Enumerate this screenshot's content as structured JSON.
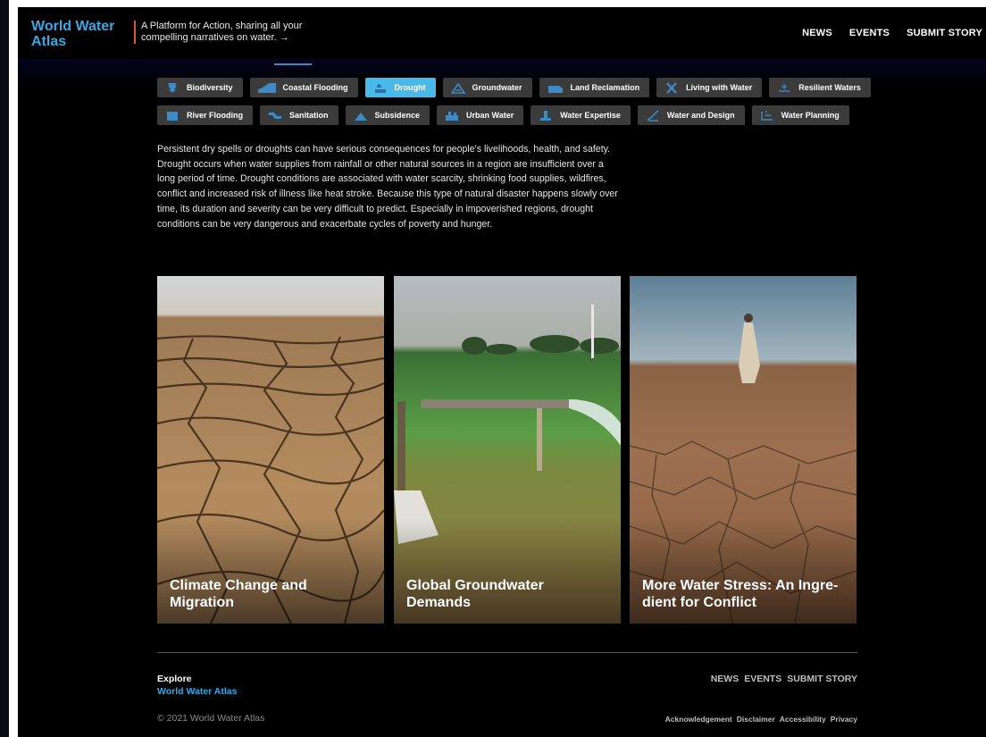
{
  "header": {
    "logo": "World Water Atlas",
    "tagline": "A Platform for Action, sharing all your compelling narratives on water. →",
    "nav": [
      "NEWS",
      "EVENTS",
      "SUBMIT STORY"
    ]
  },
  "topics": {
    "row1": [
      {
        "label": "Biodiversity",
        "icon": "biodiversity-icon"
      },
      {
        "label": "Coastal Flooding",
        "icon": "coastal-flooding-icon"
      },
      {
        "label": "Drought",
        "icon": "drought-icon"
      },
      {
        "label": "Groundwater",
        "icon": "groundwater-icon"
      },
      {
        "label": "Land Reclamation",
        "icon": "land-reclamation-icon"
      },
      {
        "label": "Living with Water",
        "icon": "living-with-water-icon"
      },
      {
        "label": "Resilient Waters",
        "icon": "resilient-waters-icon"
      }
    ],
    "row2": [
      {
        "label": "River Flooding",
        "icon": "river-flooding-icon"
      },
      {
        "label": "Sanitation",
        "icon": "sanitation-icon"
      },
      {
        "label": "Subsidence",
        "icon": "subsidence-icon"
      },
      {
        "label": "Urban Water",
        "icon": "urban-water-icon"
      },
      {
        "label": "Water Expertise",
        "icon": "water-expertise-icon"
      },
      {
        "label": "Water and Design",
        "icon": "water-and-design-icon"
      },
      {
        "label": "Water Planning",
        "icon": "water-planning-icon"
      }
    ],
    "selected": "Drought"
  },
  "description": "Persistent dry spells or droughts can have serious consequences for people's livelihoods, health, and safety. Drought occurs when water supplies from rainfall or other natural sources in a region are insufficient over a long period of time. Drought conditions are associated with water scarcity, shrinking food supplies, wildfires, conflict and increased risk of illness like heat stroke. Because this type of natural disaster happens slowly over time, its duration and severity can be very difficult to predict. Especially in impoverished regions, drought conditions can be very dangerous and exacerbate cycles of poverty and hunger.",
  "cards": [
    {
      "title": "Climate Change and Migration"
    },
    {
      "title": "Global Groundwater Demands"
    },
    {
      "title": "More Water Stress: An Ingre-dient for Conflict"
    }
  ],
  "footer": {
    "explore": "Explore",
    "explore_link": "World Water Atlas",
    "nav": [
      "NEWS",
      "EVENTS",
      "SUBMIT STORY"
    ],
    "copyright": "© 2021 World Water Atlas",
    "legal": [
      "Acknowledgement",
      "Disclaimer",
      "Accessibility",
      "Privacy"
    ]
  },
  "colors": {
    "accent": "#38a8e6",
    "active_chip": "#4ab9e8",
    "chip": "#3b3b3b",
    "tagline_bar": "#e0503a",
    "background": "#000000"
  }
}
